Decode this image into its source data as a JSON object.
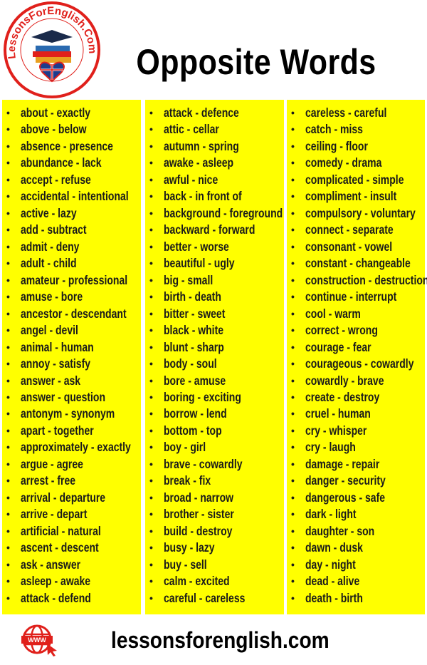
{
  "logo": {
    "text": "LessonsForEnglish.Com"
  },
  "title": "Opposite Words",
  "columns": [
    [
      "about - exactly",
      "above - below",
      "absence - presence",
      "abundance - lack",
      "accept - refuse",
      "accidental - intentional",
      "active - lazy",
      "add - subtract",
      "admit - deny",
      "adult - child",
      "amateur - professional",
      "amuse - bore",
      "ancestor - descendant",
      "angel - devil",
      "animal - human",
      "annoy - satisfy",
      "answer - ask",
      "answer - question",
      "antonym - synonym",
      "apart - together",
      "approximately - exactly",
      "argue - agree",
      "arrest - free",
      "arrival - departure",
      "arrive - depart",
      "artificial - natural",
      "ascent - descent",
      "ask - answer",
      "asleep - awake",
      "attack - defend"
    ],
    [
      "attack - defence",
      "attic - cellar",
      "autumn - spring",
      "awake - asleep",
      "awful - nice",
      "back - in front of",
      "background - foreground",
      "backward - forward",
      "better - worse",
      "beautiful - ugly",
      "big - small",
      "birth - death",
      "bitter - sweet",
      "black - white",
      "blunt - sharp",
      "body - soul",
      "bore - amuse",
      "boring - exciting",
      "borrow - lend",
      "bottom - top",
      "boy - girl",
      "brave - cowardly",
      "break - fix",
      "broad - narrow",
      "brother - sister",
      "build - destroy",
      "busy - lazy",
      "buy - sell",
      "calm - excited",
      "careful - careless"
    ],
    [
      "careless - careful",
      "catch - miss",
      "ceiling - floor",
      "comedy - drama",
      "complicated - simple",
      "compliment - insult",
      "compulsory - voluntary",
      "connect - separate",
      "consonant - vowel",
      "constant - changeable",
      "construction - destruction",
      "continue - interrupt",
      "cool - warm",
      "correct - wrong",
      "courage - fear",
      "courageous - cowardly",
      "cowardly - brave",
      "create - destroy",
      "cruel - human",
      "cry - whisper",
      "cry - laugh",
      "damage - repair",
      "danger - security",
      "dangerous - safe",
      "dark - light",
      "daughter - son",
      "dawn - dusk",
      "day - night",
      "dead - alive",
      "death - birth"
    ]
  ],
  "bullet": "•",
  "footer": {
    "url": "lessonsforenglish.com",
    "icon": "globe-www-icon"
  },
  "colors": {
    "panel": "#ffff00",
    "brand_red": "#e0201b",
    "text": "#1a1a1a"
  }
}
